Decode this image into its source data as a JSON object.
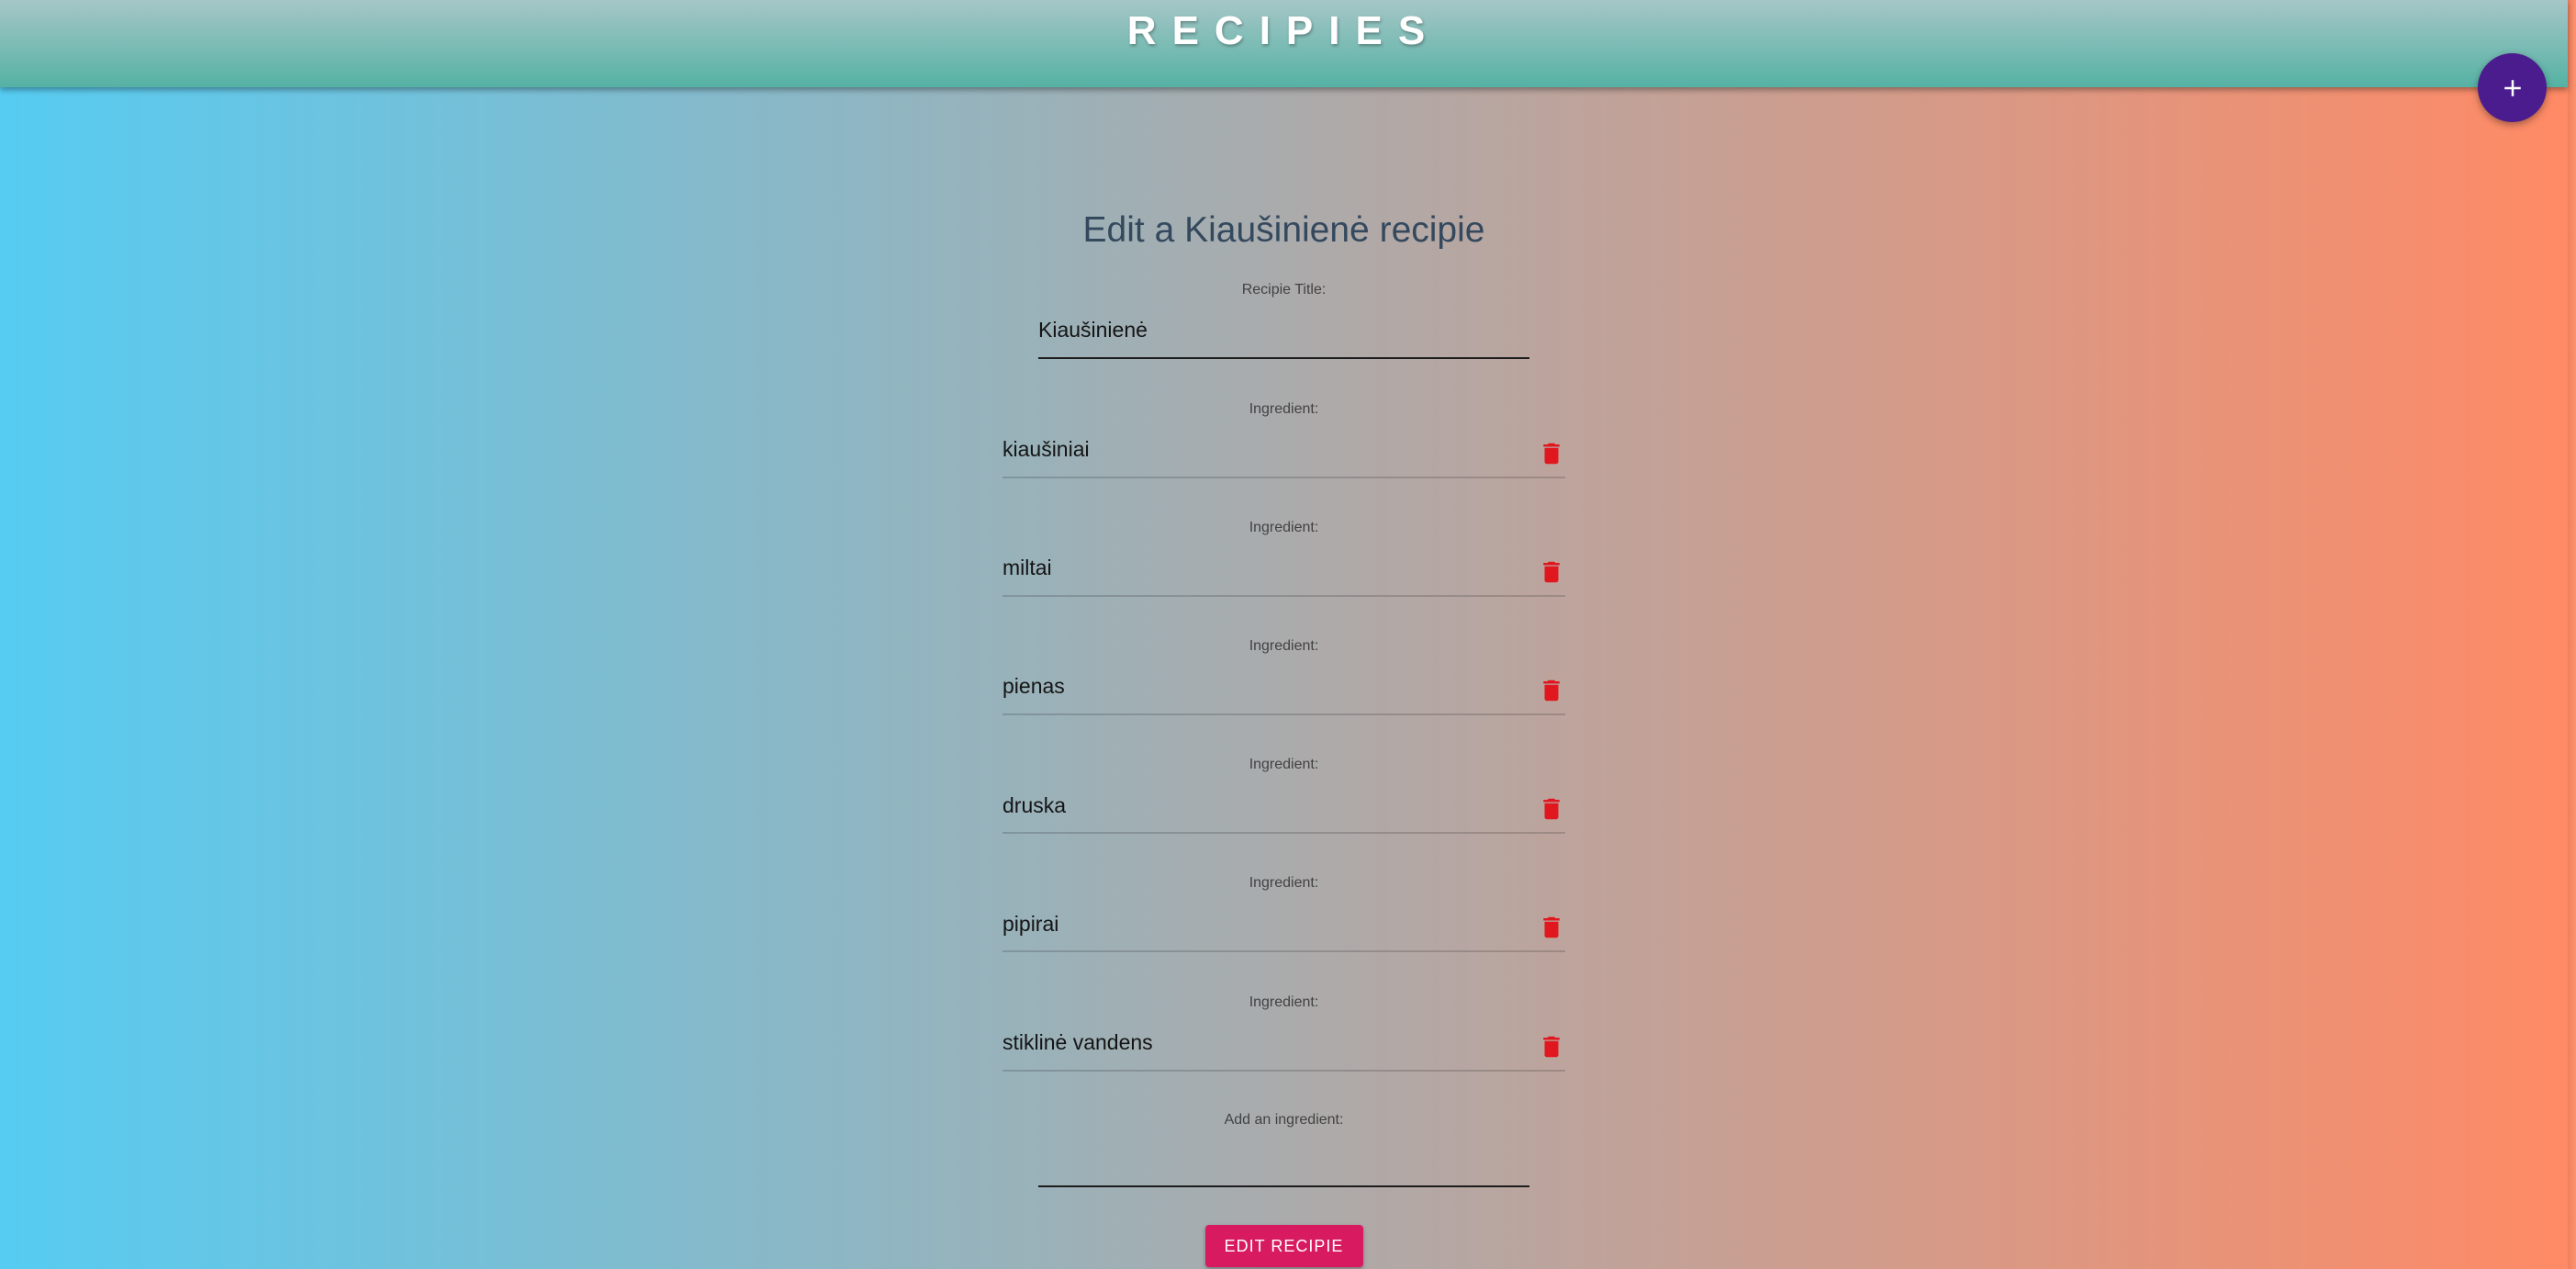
{
  "app": {
    "title": "RECIPIES"
  },
  "fab": {
    "icon": "plus-icon"
  },
  "page": {
    "heading": "Edit a Kiaušinienė recipie"
  },
  "form": {
    "title_field": {
      "label": "Recipie Title:",
      "value": "Kiaušinienė"
    },
    "ingredients": [
      {
        "label": "Ingredient:",
        "value": "kiaušiniai",
        "delete_icon": "trash-icon"
      },
      {
        "label": "Ingredient:",
        "value": "miltai",
        "delete_icon": "trash-icon"
      },
      {
        "label": "Ingredient:",
        "value": "pienas",
        "delete_icon": "trash-icon"
      },
      {
        "label": "Ingredient:",
        "value": "druska",
        "delete_icon": "trash-icon"
      },
      {
        "label": "Ingredient:",
        "value": "pipirai",
        "delete_icon": "trash-icon"
      },
      {
        "label": "Ingredient:",
        "value": "stiklinė vandens",
        "delete_icon": "trash-icon"
      }
    ],
    "new_ingredient": {
      "label": "Add an ingredient:",
      "value": ""
    },
    "submit_label": "EDIT RECIPIE"
  },
  "colors": {
    "background_gradient": [
      "#56ccf2",
      "#ff8a65"
    ],
    "header_gradient": [
      "#a6c6c7",
      "#55b2a4"
    ],
    "add_button": "#4b1c8e",
    "delete_icon": "#e0171f",
    "submit_button": "#d81b60",
    "heading_text": "#34495e"
  }
}
